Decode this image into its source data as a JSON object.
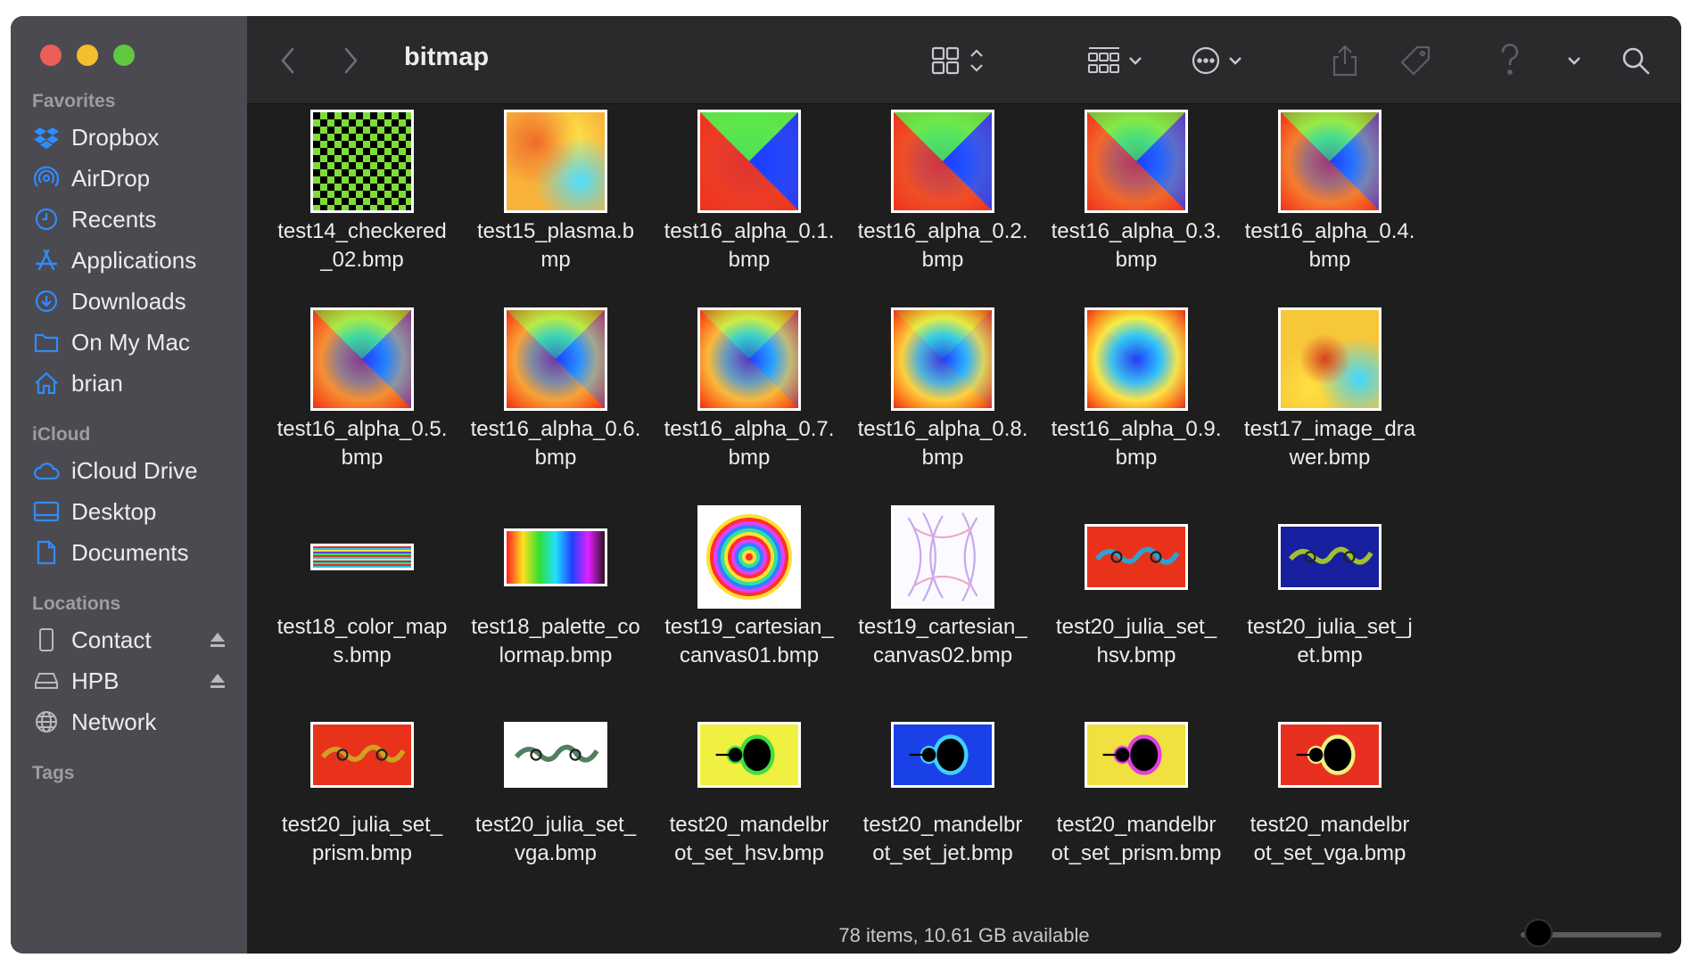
{
  "window": {
    "title": "bitmap",
    "status": "78 items, 10.61 GB available",
    "zoom_level": 0.14
  },
  "sidebar": {
    "sections": [
      {
        "label": "Favorites"
      },
      {
        "label": "iCloud"
      },
      {
        "label": "Locations"
      },
      {
        "label": "Tags"
      }
    ],
    "favorites": [
      {
        "label": "Dropbox",
        "icon": "dropbox-icon"
      },
      {
        "label": "AirDrop",
        "icon": "airdrop-icon"
      },
      {
        "label": "Recents",
        "icon": "clock-icon"
      },
      {
        "label": "Applications",
        "icon": "applications-icon"
      },
      {
        "label": "Downloads",
        "icon": "download-icon"
      },
      {
        "label": "On My Mac",
        "icon": "folder-icon"
      },
      {
        "label": "brian",
        "icon": "home-icon"
      }
    ],
    "icloud": [
      {
        "label": "iCloud Drive",
        "icon": "cloud-icon"
      },
      {
        "label": "Desktop",
        "icon": "desktop-icon"
      },
      {
        "label": "Documents",
        "icon": "document-icon"
      }
    ],
    "locations": [
      {
        "label": "Contact",
        "icon": "phone-icon"
      },
      {
        "label": "HPB",
        "icon": "drive-icon"
      },
      {
        "label": "Network",
        "icon": "network-icon"
      }
    ]
  },
  "colors": {
    "sidebar_bg": "#4b4a50",
    "content_bg": "#1e1e1e",
    "accent_blue": "#2f8cff"
  },
  "files": [
    {
      "name": "test14_checkered_02.bmp",
      "line1": "test14_checkered",
      "line2": "_02.bmp",
      "thumb": "checker"
    },
    {
      "name": "test15_plasma.bmp",
      "line1": "test15_plasma.b",
      "line2": "mp",
      "thumb": "plasma"
    },
    {
      "name": "test16_alpha_0.1.bmp",
      "line1": "test16_alpha_0.1.",
      "line2": "bmp",
      "thumb": "alpha1"
    },
    {
      "name": "test16_alpha_0.2.bmp",
      "line1": "test16_alpha_0.2.",
      "line2": "bmp",
      "thumb": "alpha2"
    },
    {
      "name": "test16_alpha_0.3.bmp",
      "line1": "test16_alpha_0.3.",
      "line2": "bmp",
      "thumb": "alpha3"
    },
    {
      "name": "test16_alpha_0.4.bmp",
      "line1": "test16_alpha_0.4.",
      "line2": "bmp",
      "thumb": "alpha4"
    },
    {
      "name": "test16_alpha_0.5.bmp",
      "line1": "test16_alpha_0.5.",
      "line2": "bmp",
      "thumb": "alpha5"
    },
    {
      "name": "test16_alpha_0.6.bmp",
      "line1": "test16_alpha_0.6.",
      "line2": "bmp",
      "thumb": "alpha6"
    },
    {
      "name": "test16_alpha_0.7.bmp",
      "line1": "test16_alpha_0.7.",
      "line2": "bmp",
      "thumb": "alpha7"
    },
    {
      "name": "test16_alpha_0.8.bmp",
      "line1": "test16_alpha_0.8.",
      "line2": "bmp",
      "thumb": "alpha8"
    },
    {
      "name": "test16_alpha_0.9.bmp",
      "line1": "test16_alpha_0.9.",
      "line2": "bmp",
      "thumb": "alpha9"
    },
    {
      "name": "test17_image_drawer.bmp",
      "line1": "test17_image_dra",
      "line2": "wer.bmp",
      "thumb": "drawer"
    },
    {
      "name": "test18_color_maps.bmp",
      "line1": "test18_color_map",
      "line2": "s.bmp",
      "thumb": "colormaps"
    },
    {
      "name": "test18_palette_colormap.bmp",
      "line1": "test18_palette_co",
      "line2": "lormap.bmp",
      "thumb": "palette"
    },
    {
      "name": "test19_cartesian_canvas01.bmp",
      "line1": "test19_cartesian_",
      "line2": "canvas01.bmp",
      "thumb": "rings"
    },
    {
      "name": "test19_cartesian_canvas02.bmp",
      "line1": "test19_cartesian_",
      "line2": "canvas02.bmp",
      "thumb": "spiral"
    },
    {
      "name": "test20_julia_set_hsv.bmp",
      "line1": "test20_julia_set_",
      "line2": "hsv.bmp",
      "thumb": "julia_hsv"
    },
    {
      "name": "test20_julia_set_jet.bmp",
      "line1": "test20_julia_set_j",
      "line2": "et.bmp",
      "thumb": "julia_jet"
    },
    {
      "name": "test20_julia_set_prism.bmp",
      "line1": "test20_julia_set_",
      "line2": "prism.bmp",
      "thumb": "julia_prism"
    },
    {
      "name": "test20_julia_set_vga.bmp",
      "line1": "test20_julia_set_",
      "line2": "vga.bmp",
      "thumb": "julia_vga"
    },
    {
      "name": "test20_mandelbrot_set_hsv.bmp",
      "line1": "test20_mandelbr",
      "line2": "ot_set_hsv.bmp",
      "thumb": "mandel_hsv"
    },
    {
      "name": "test20_mandelbrot_set_jet.bmp",
      "line1": "test20_mandelbr",
      "line2": "ot_set_jet.bmp",
      "thumb": "mandel_jet"
    },
    {
      "name": "test20_mandelbrot_set_prism.bmp",
      "line1": "test20_mandelbr",
      "line2": "ot_set_prism.bmp",
      "thumb": "mandel_prism"
    },
    {
      "name": "test20_mandelbrot_set_vga.bmp",
      "line1": "test20_mandelbr",
      "line2": "ot_set_vga.bmp",
      "thumb": "mandel_vga"
    }
  ]
}
